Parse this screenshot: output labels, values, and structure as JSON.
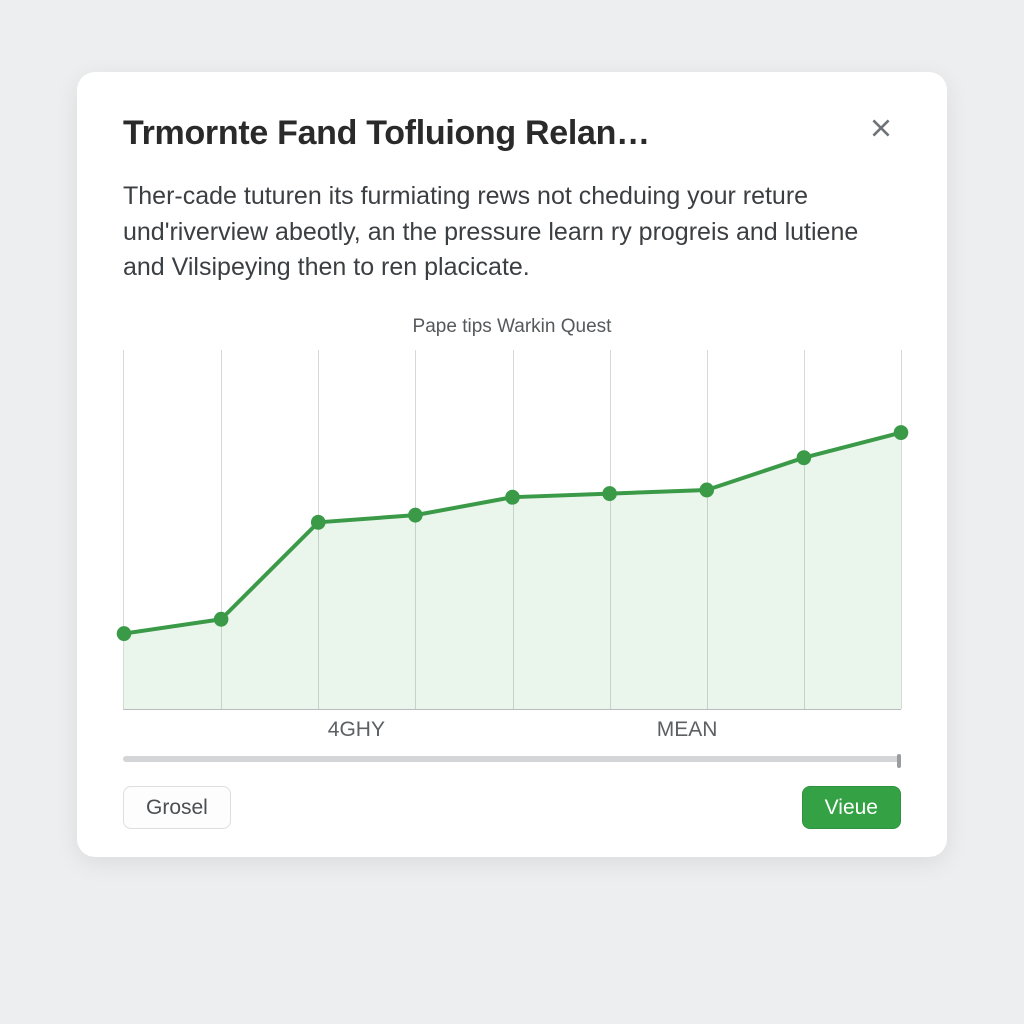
{
  "modal": {
    "title": "Trmornte Fand Tofluiong Relan…",
    "description": "Ther-cade tuturen its furmiating rews not cheduing your reture und'riverview abeotly, an the pressure learn ry progreis and lutiene and Vilsipeying then to ren placicate.",
    "close_label": "Close"
  },
  "chart_data": {
    "type": "line",
    "title": "Pape tips Warkin Quest",
    "xlabel": "",
    "ylabel": "",
    "ylim": [
      0,
      100
    ],
    "x": [
      0,
      1,
      2,
      3,
      4,
      5,
      6,
      7,
      8
    ],
    "values": [
      21,
      25,
      52,
      54,
      59,
      60,
      61,
      70,
      77
    ],
    "x_ticks": [
      {
        "pos": 2.4,
        "label": "4GHY"
      },
      {
        "pos": 5.8,
        "label": "MEAN"
      }
    ],
    "gridlines": [
      1,
      2,
      3,
      4,
      5,
      6,
      7,
      8
    ]
  },
  "footer": {
    "secondary_label": "Grosel",
    "primary_label": "Vieue"
  }
}
